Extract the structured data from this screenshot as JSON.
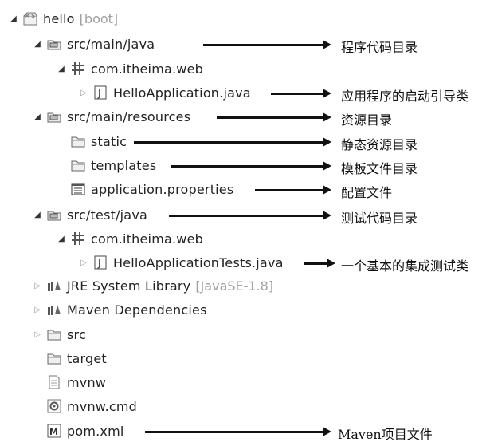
{
  "tree": {
    "project": {
      "name": "hello",
      "decoration": "[boot]"
    },
    "src_main_java": "src/main/java",
    "pkg_main": "com.itheima.web",
    "hello_app": "HelloApplication.java",
    "src_main_resources": "src/main/resources",
    "static": "static",
    "templates": "templates",
    "app_props": "application.properties",
    "src_test_java": "src/test/java",
    "pkg_test": "com.itheima.web",
    "hello_app_tests": "HelloApplicationTests.java",
    "jre": {
      "name": "JRE System Library",
      "decoration": "[JavaSE-1.8]"
    },
    "maven_deps": "Maven Dependencies",
    "src": "src",
    "target": "target",
    "mvnw": "mvnw",
    "mvnw_cmd": "mvnw.cmd",
    "pom": "pom.xml"
  },
  "annotations": {
    "src_main_java": "程序代码目录",
    "hello_app": "应用程序的启动引导类",
    "src_main_resources": "资源目录",
    "static": "静态资源目录",
    "templates": "模板文件目录",
    "app_props": "配置文件",
    "src_test_java": "测试代码目录",
    "hello_app_tests": "一个基本的集成测试类",
    "pom": "Maven项目文件"
  }
}
